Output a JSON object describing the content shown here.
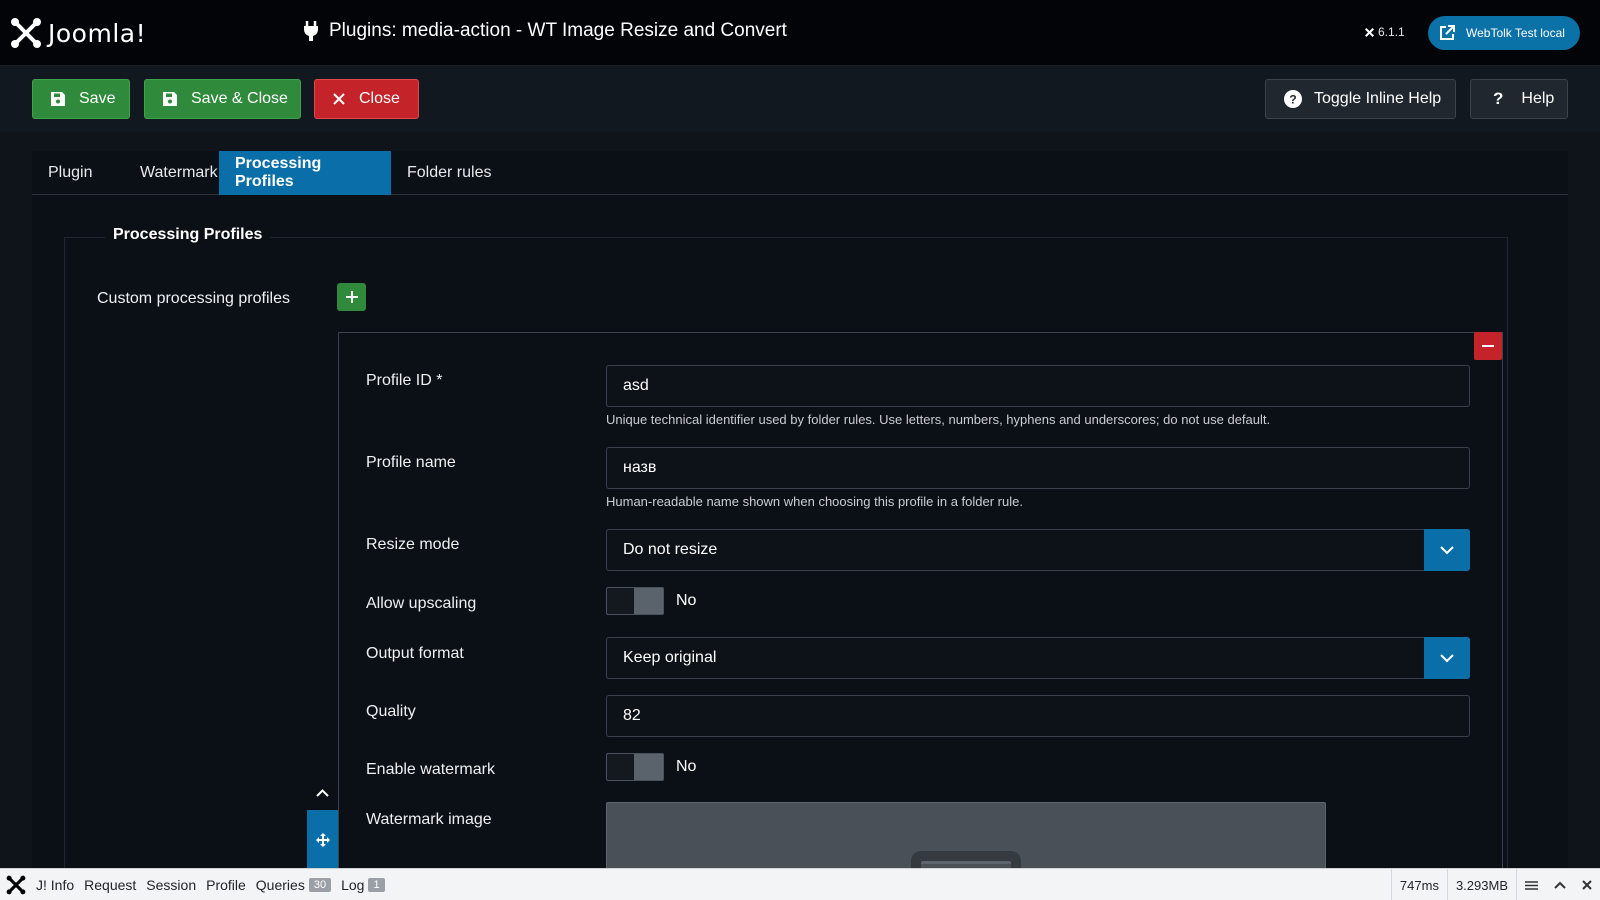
{
  "header": {
    "logo_text": "Joomla!",
    "title": "Plugins: media-action - WT Image Resize and Convert",
    "version": "6.1.1",
    "site_button": "WebTolk Test local"
  },
  "toolbar": {
    "save": "Save",
    "save_close": "Save & Close",
    "close": "Close",
    "toggle_help": "Toggle Inline Help",
    "help": "Help"
  },
  "tabs": [
    "Plugin",
    "Watermark",
    "Processing Profiles",
    "Folder rules"
  ],
  "section": {
    "legend": "Processing Profiles",
    "custom_label": "Custom processing profiles"
  },
  "profile": {
    "profile_id_label": "Profile ID *",
    "profile_id_value": "asd",
    "profile_id_hint": "Unique technical identifier used by folder rules. Use letters, numbers, hyphens and underscores; do not use default.",
    "profile_name_label": "Profile name",
    "profile_name_value": "назв",
    "profile_name_hint": "Human-readable name shown when choosing this profile in a folder rule.",
    "resize_mode_label": "Resize mode",
    "resize_mode_value": "Do not resize",
    "upscaling_label": "Allow upscaling",
    "upscaling_value": "No",
    "output_format_label": "Output format",
    "output_format_value": "Keep original",
    "quality_label": "Quality",
    "quality_value": "82",
    "watermark_label": "Enable watermark",
    "watermark_value": "No",
    "watermark_image_label": "Watermark image"
  },
  "debugbar": {
    "info": "J! Info",
    "request": "Request",
    "session": "Session",
    "profile": "Profile",
    "queries": "Queries",
    "queries_count": "30",
    "log": "Log",
    "log_count": "1",
    "time": "747ms",
    "memory": "3.293MB"
  },
  "colors": {
    "primary": "#0a6fa9",
    "success": "#2f8a3b",
    "danger": "#c5232a"
  }
}
